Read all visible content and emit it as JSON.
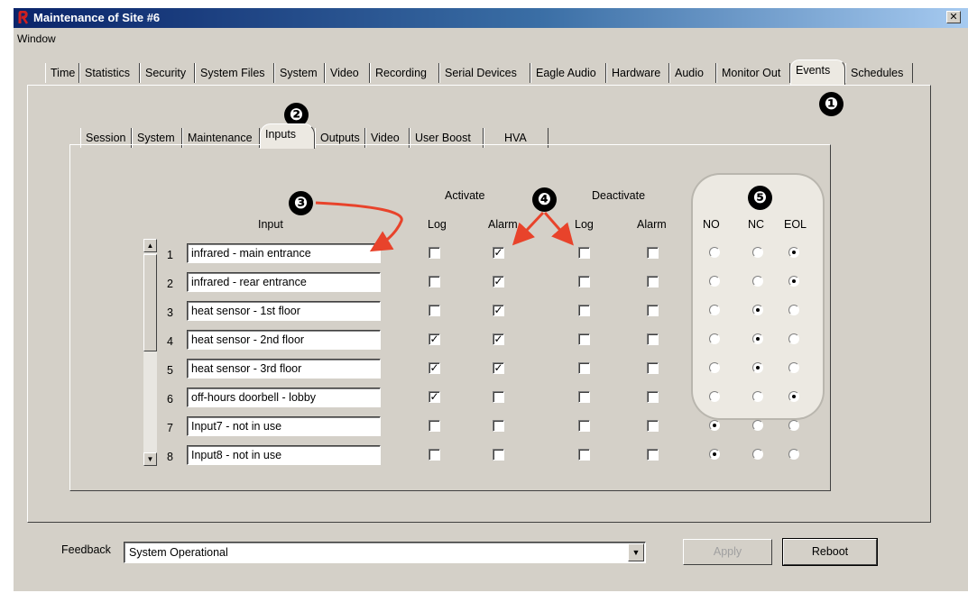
{
  "window": {
    "title": "Maintenance of Site #6",
    "close": "✕"
  },
  "menu": {
    "window": "Window"
  },
  "main_tabs": [
    "Time",
    "Statistics",
    "Security",
    "System Files",
    "System",
    "Video",
    "Recording",
    "Serial Devices",
    "Eagle Audio",
    "Hardware",
    "Audio",
    "Monitor Out",
    "Events",
    "Schedules"
  ],
  "active_main_tab": "Events",
  "sub_tabs": [
    "Session",
    "System",
    "Maintenance",
    "Inputs",
    "Outputs",
    "Video",
    "User Boost",
    "HVA"
  ],
  "active_sub_tab": "Inputs",
  "headers": {
    "input": "Input",
    "activate": "Activate",
    "deactivate": "Deactivate",
    "log": "Log",
    "alarm": "Alarm",
    "no": "NO",
    "nc": "NC",
    "eol": "EOL"
  },
  "inputs": [
    {
      "num": "1",
      "name": "infrared - main entrance",
      "act_log": false,
      "act_alarm": true,
      "deact_log": false,
      "deact_alarm": false,
      "contact": "EOL"
    },
    {
      "num": "2",
      "name": "infrared - rear entrance",
      "act_log": false,
      "act_alarm": true,
      "deact_log": false,
      "deact_alarm": false,
      "contact": "EOL"
    },
    {
      "num": "3",
      "name": "heat sensor - 1st floor",
      "act_log": false,
      "act_alarm": true,
      "deact_log": false,
      "deact_alarm": false,
      "contact": "NC"
    },
    {
      "num": "4",
      "name": "heat sensor - 2nd floor",
      "act_log": true,
      "act_alarm": true,
      "deact_log": false,
      "deact_alarm": false,
      "contact": "NC"
    },
    {
      "num": "5",
      "name": "heat sensor - 3rd floor",
      "act_log": true,
      "act_alarm": true,
      "deact_log": false,
      "deact_alarm": false,
      "contact": "NC"
    },
    {
      "num": "6",
      "name": "off-hours doorbell - lobby",
      "act_log": true,
      "act_alarm": false,
      "deact_log": false,
      "deact_alarm": false,
      "contact": "EOL"
    },
    {
      "num": "7",
      "name": "Input7 - not in use",
      "act_log": false,
      "act_alarm": false,
      "deact_log": false,
      "deact_alarm": false,
      "contact": "NO"
    },
    {
      "num": "8",
      "name": "Input8 - not in use",
      "act_log": false,
      "act_alarm": false,
      "deact_log": false,
      "deact_alarm": false,
      "contact": "NO"
    }
  ],
  "callouts": [
    "❶",
    "❷",
    "❸",
    "❹",
    "❺"
  ],
  "feedback": {
    "label": "Feedback",
    "value": "System Operational"
  },
  "buttons": {
    "apply": "Apply",
    "reboot": "Reboot"
  },
  "colors": {
    "annotation_arrow": "#e8432b",
    "title_bar": "#0a246a"
  }
}
